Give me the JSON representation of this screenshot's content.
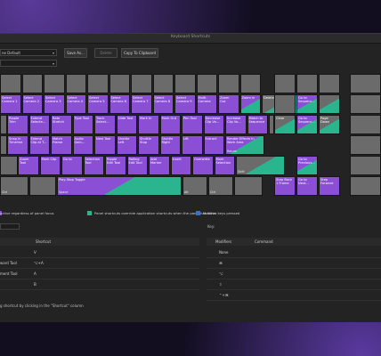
{
  "window": {
    "title": "Keyboard Shortcuts"
  },
  "toolbar": {
    "preset_value": "ne Default",
    "save_label": "Save As...",
    "delete_label": "Delete",
    "copy_label": "Copy To Clipboard"
  },
  "keys": [
    {
      "label": "",
      "sub": "",
      "c": "k-gray"
    },
    {
      "label": "",
      "sub": "",
      "c": "k-gray"
    }
  ],
  "row1": [
    "",
    "",
    "",
    "",
    "",
    "",
    "",
    "",
    "",
    "",
    "",
    ""
  ],
  "row2": [
    {
      "label": "Select\nCamera 1",
      "c": "k-purple"
    },
    {
      "label": "Select\nCamera 2",
      "c": "k-purple"
    },
    {
      "label": "Select\nCamera 3",
      "c": "k-purple"
    },
    {
      "label": "Select\nCamera 4",
      "c": "k-purple"
    },
    {
      "label": "Select\nCamera 5",
      "c": "k-purple"
    },
    {
      "label": "Select\nCamera 6",
      "c": "k-purple"
    },
    {
      "label": "Select\nCamera 7",
      "c": "k-purple"
    },
    {
      "label": "Select\nCamera 8",
      "c": "k-purple"
    },
    {
      "label": "Select\nCamera 9",
      "c": "k-purple"
    },
    {
      "label": "Multi-\nCamera",
      "c": "k-purple"
    },
    {
      "label": "Zoom\nOut",
      "c": "k-purple"
    },
    {
      "label": "Zoom in",
      "c": "k-mix"
    },
    {
      "label": "Delete",
      "c": "k-mixg"
    }
  ],
  "row3": [
    {
      "label": "Ripple\nTrim",
      "c": "k-purple"
    },
    {
      "label": "Extend\nSelecte...",
      "c": "k-purple"
    },
    {
      "label": "Rate\nStretch",
      "c": "k-purple"
    },
    {
      "label": "Type Tool",
      "c": "k-purple"
    },
    {
      "label": "Track\nSelect...",
      "c": "k-purple"
    },
    {
      "label": "Slide Tool",
      "c": "k-purple"
    },
    {
      "label": "Mark In",
      "c": "k-purple"
    },
    {
      "label": "Mark Out",
      "c": "k-purple"
    },
    {
      "label": "Pen Tool",
      "c": "k-purple"
    },
    {
      "label": "Decrease\nClip Vo...",
      "c": "k-purple"
    },
    {
      "label": "Increase\nClip Vo...",
      "c": "k-purple"
    },
    {
      "label": "Match to\nSequence",
      "c": "k-purple"
    }
  ],
  "row4": [
    {
      "label": "Snap in\nTimeline",
      "c": "k-purple"
    },
    {
      "label": "Extend\nClip at T...",
      "c": "k-purple"
    },
    {
      "label": "Match\nFrame",
      "c": "k-purple"
    },
    {
      "label": "Audio\nGain...",
      "c": "k-purple"
    },
    {
      "label": "Nest Tool",
      "c": "k-purple"
    },
    {
      "label": "Shuttle\nLeft",
      "c": "k-purple"
    },
    {
      "label": "Shuttle\nStop",
      "c": "k-purple"
    },
    {
      "label": "Shuttle\nRight",
      "c": "k-purple"
    },
    {
      "label": "Lift",
      "c": "k-purple"
    },
    {
      "label": "Extract",
      "c": "k-purple"
    },
    {
      "label": "Render Effects In\nWork Area",
      "c": "k-mix"
    }
  ],
  "row5": [
    {
      "label": "Zoom\nTool",
      "c": "k-purple"
    },
    {
      "label": "Mark Clip",
      "c": "k-purple"
    },
    {
      "label": "Go to",
      "c": "k-purple"
    },
    {
      "label": "Selection\nTool",
      "c": "k-purple"
    },
    {
      "label": "Ripple\nEdit Tool",
      "c": "k-purple"
    },
    {
      "label": "Rolling\nEdit Tool",
      "c": "k-purple"
    },
    {
      "label": "Add\nMarker",
      "c": "k-purple"
    },
    {
      "label": "Insert",
      "c": "k-purple"
    },
    {
      "label": "Overwrite",
      "c": "k-purple"
    },
    {
      "label": "Mark\nSelection",
      "c": "k-purple"
    },
    {
      "label": "",
      "c": "k-mixg"
    }
  ],
  "row6": {
    "ctrl": "Ctrl",
    "alt": "",
    "space": "Play-Stop Toggle",
    "space_sub": "Space",
    "alt2": "Alt",
    "ctrl2": "Ctrl"
  },
  "nav": {
    "insert": "Clear",
    "goto_seq": "Go to\nSequenc...",
    "clear_sub": "Forward\nDelete",
    "page_up": "Go to\nSequenc...",
    "page_down": "Page\nDown",
    "up": "Go to\nPrevious...",
    "step_back": "Step Back\n1 Frame",
    "go_end": "Go to\nNext...",
    "step_fwd": "Step\nForward"
  },
  "numpad": [
    "",
    "",
    "",
    "",
    "",
    "",
    "",
    "",
    "",
    "",
    "",
    "",
    "",
    "",
    "",
    ""
  ],
  "legend": {
    "app": "active regardless of panel focus",
    "panel": "Panel shortcuts override application shortcuts when the panel has focus",
    "modifier": "Modifier keys pressed"
  },
  "table": {
    "col_shortcut": "Shortcut",
    "rows": [
      {
        "name": "",
        "shortcut": "V"
      },
      {
        "name": "ward Tool",
        "shortcut": "⌥+A"
      },
      {
        "name": "ment Tool",
        "shortcut": "A"
      },
      {
        "name": "",
        "shortcut": "B"
      }
    ]
  },
  "keys_panel": {
    "title": "Key:",
    "col_modifiers": "Modifiers",
    "col_command": "Command",
    "rows": [
      {
        "mod": "None"
      },
      {
        "mod": "⌘"
      },
      {
        "mod": "⌥"
      },
      {
        "mod": "⇧"
      },
      {
        "mod": "⌃+⌘"
      }
    ]
  },
  "status": "g shortcut by clicking in the \"Shortcut\" column",
  "colors": {
    "application": "#8a4fd4",
    "panel": "#2bb58f",
    "modifier": "#3a6fd0"
  }
}
